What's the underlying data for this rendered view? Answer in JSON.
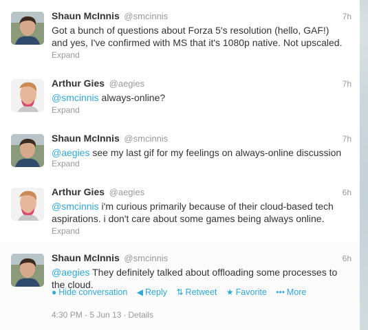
{
  "tweets": [
    {
      "name": "Shaun McInnis",
      "handle": "@smcinnis",
      "time": "7h",
      "line1": "Got a bunch of questions about Forza 5's resolution (hello, GAF!)",
      "line2": "and yes, I've confirmed with MS that it's 1080p native. Not upscaled.",
      "expand": "Expand",
      "avatar": "shaun-avatar"
    },
    {
      "name": "Arthur Gies",
      "handle": "@aegies",
      "time": "7h",
      "mention": "@smcinnis",
      "line1": " always-online?",
      "expand": "Expand",
      "avatar": "arthur-avatar"
    },
    {
      "name": "Shaun McInnis",
      "handle": "@smcinnis",
      "time": "7h",
      "mention": "@aegies",
      "line1": " see my last gif for my feelings on always-online discussion",
      "expand": "Expand",
      "avatar": "shaun-avatar"
    },
    {
      "name": "Arthur Gies",
      "handle": "@aegies",
      "time": "6h",
      "mention": "@smcinnis",
      "line1": " i'm curious primarily because of their cloud-based tech",
      "line2": "aspirations. i don't care about some games being always online.",
      "expand": "Expand",
      "avatar": "arthur-avatar"
    },
    {
      "name": "Shaun McInnis",
      "handle": "@smcinnis",
      "time": "6h",
      "mention": "@aegies",
      "line1": " They definitely talked about offloading some processes to",
      "line2": "the cloud.",
      "avatar": "shaun-avatar"
    }
  ],
  "actions": {
    "hide": "Hide conversation",
    "reply": "Reply",
    "retweet": "Retweet",
    "favorite": "Favorite",
    "more": "More"
  },
  "meta": {
    "timestamp": "4:30 PM - 5 Jun 13",
    "separator": "·",
    "details": "Details"
  },
  "icons": {
    "hide": "speech-bubble-icon",
    "reply": "reply-arrow-icon",
    "retweet": "retweet-icon",
    "favorite": "star-icon",
    "more": "ellipsis-icon"
  },
  "colors": {
    "link": "#2fa8d6",
    "name": "#333333",
    "muted": "#999999"
  }
}
